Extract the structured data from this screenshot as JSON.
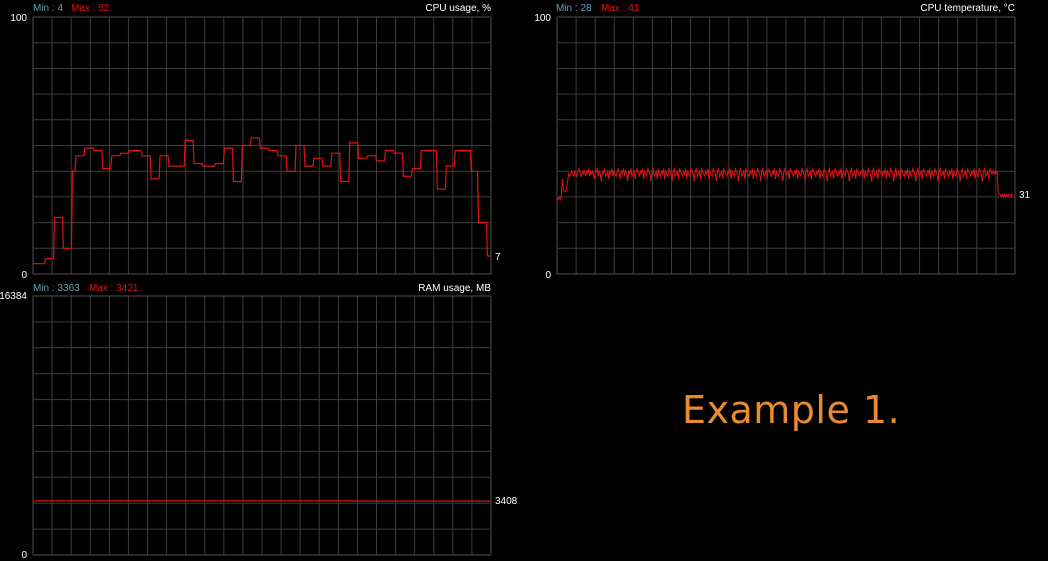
{
  "caption": "Example 1.",
  "colors": {
    "background": "#000000",
    "grid": "#3c3c3c",
    "plot_border": "#505050",
    "line": "#e01212",
    "min_text": "#6aa0b4",
    "max_text": "#e01212",
    "label_text": "#ffffff",
    "caption": "#e88b2e"
  },
  "chart_data": [
    {
      "type": "line",
      "title": "CPU usage, %",
      "min_label": "Min : 4",
      "max_label": "Max : 52",
      "y_top_label": "100",
      "y_bottom_label": "0",
      "current_label": "7",
      "ylim": [
        0,
        100
      ],
      "grid": true,
      "x_divisions": 24,
      "y_divisions": 10,
      "x": [
        0,
        1,
        2,
        3,
        4,
        5,
        6,
        7,
        8,
        9,
        10,
        11,
        12,
        13,
        14,
        15,
        16,
        17,
        18,
        19,
        20,
        21,
        22,
        23,
        24,
        25,
        26,
        27,
        28,
        29,
        30,
        31,
        32,
        33,
        34,
        35,
        36,
        37,
        38,
        39,
        40,
        41,
        42,
        43,
        44,
        45,
        46,
        47,
        48,
        49,
        50,
        51,
        52,
        53,
        54,
        55,
        56,
        57,
        58,
        59,
        60,
        61,
        62,
        63,
        64,
        65,
        66,
        67,
        68,
        69,
        70,
        71,
        72,
        73,
        74,
        75,
        76,
        77,
        78,
        79,
        80,
        81,
        82,
        83,
        84,
        85,
        86,
        87,
        88,
        89,
        90,
        91,
        92,
        93,
        94,
        95,
        96,
        97,
        98,
        99,
        100,
        101,
        102,
        103,
        104,
        105,
        106,
        107,
        108,
        109,
        110,
        111,
        112,
        113,
        114,
        115,
        116,
        117,
        118,
        119,
        120,
        121,
        122,
        123,
        124,
        125,
        126,
        127,
        128,
        129,
        130,
        131,
        132,
        133,
        134,
        135,
        136,
        137,
        138,
        139,
        140,
        141,
        142,
        143,
        144,
        145,
        146,
        147,
        148,
        149,
        150,
        151,
        152,
        153,
        154,
        155,
        156,
        157,
        158,
        159,
        160,
        161,
        162,
        163,
        164,
        165,
        166,
        167,
        168,
        169,
        170,
        171,
        172,
        173,
        174,
        175,
        176,
        177,
        178,
        179,
        180,
        181,
        182,
        183,
        184,
        185,
        186,
        187,
        188,
        189,
        190,
        191,
        192,
        193,
        194,
        195,
        196,
        197,
        198,
        199,
        200,
        201,
        202,
        203,
        204,
        205,
        206,
        207,
        208,
        209,
        210,
        211,
        212,
        213,
        214,
        215,
        216,
        217,
        218,
        219,
        220,
        221,
        222,
        223,
        224,
        225,
        226,
        227,
        228,
        229,
        230,
        231,
        232,
        233,
        234,
        235,
        236,
        237,
        238,
        239,
        240,
        241,
        242,
        243,
        244,
        245,
        246,
        247,
        248,
        249,
        250,
        251,
        252,
        253,
        254,
        255,
        256,
        257,
        258,
        259,
        260,
        261,
        262,
        263,
        264,
        265,
        266,
        267,
        268,
        269,
        270,
        271,
        272,
        273,
        274,
        275,
        276,
        277,
        278,
        279,
        280,
        281,
        282,
        283,
        284,
        285,
        286,
        287,
        288,
        289,
        290,
        291,
        292,
        293,
        294,
        295,
        296,
        297,
        298,
        299,
        300,
        301,
        302,
        303,
        304,
        305,
        306,
        307,
        308,
        309,
        310,
        311,
        312,
        313,
        314,
        315,
        316,
        317,
        318,
        319,
        320,
        321,
        322,
        323,
        324,
        325,
        326,
        327,
        328,
        329,
        330,
        331,
        332,
        333,
        334,
        335,
        336,
        337,
        338,
        339,
        340,
        341,
        342,
        343,
        344,
        345,
        346,
        347,
        348,
        349,
        350,
        351,
        352,
        353,
        354,
        355,
        356,
        357,
        358,
        359,
        360,
        361,
        362,
        363,
        364,
        365,
        366,
        367,
        368,
        369,
        370,
        371,
        372,
        373,
        374,
        375,
        376,
        377,
        378,
        379,
        380,
        381,
        382,
        383,
        384,
        385,
        386,
        387,
        388,
        389,
        390,
        391,
        392,
        393,
        394,
        395,
        396,
        397,
        398,
        399,
        400,
        401,
        402,
        403,
        404,
        405,
        406,
        407,
        408,
        409,
        410,
        411,
        412,
        413,
        414,
        415,
        416,
        417,
        418,
        419,
        420,
        421,
        422,
        423,
        424,
        425,
        426,
        427,
        428,
        429,
        430,
        431,
        432,
        433,
        434,
        435,
        436,
        437,
        438,
        439,
        440,
        441,
        442,
        443,
        444,
        445,
        446,
        447,
        448,
        449,
        450,
        451,
        452,
        453,
        454,
        455
      ],
      "values": [
        4,
        4,
        4,
        4,
        4,
        4,
        4,
        4,
        4,
        4,
        4,
        4,
        4,
        4,
        6,
        6,
        6,
        6,
        6,
        6,
        6,
        6,
        6,
        6,
        22,
        22,
        22,
        22,
        22,
        22,
        22,
        22,
        22,
        22,
        10,
        10,
        10,
        10,
        10,
        10,
        10,
        10,
        10,
        10,
        40,
        40,
        40,
        40,
        46,
        46,
        46,
        46,
        46,
        46,
        46,
        46,
        46,
        46,
        49,
        49,
        49,
        49,
        49,
        49,
        49,
        49,
        49,
        49,
        48,
        48,
        48,
        48,
        48,
        48,
        48,
        48,
        48,
        48,
        41,
        41,
        41,
        41,
        41,
        41,
        41,
        41,
        41,
        41,
        46,
        46,
        46,
        46,
        46,
        46,
        46,
        46,
        46,
        46,
        47,
        47,
        47,
        47,
        47,
        47,
        47,
        47,
        47,
        47,
        48,
        48,
        48,
        48,
        48,
        48,
        48,
        48,
        48,
        48,
        48,
        48,
        48,
        48,
        46,
        46,
        46,
        46,
        46,
        46,
        46,
        46,
        46,
        46,
        37,
        37,
        37,
        37,
        37,
        37,
        37,
        37,
        37,
        37,
        46,
        46,
        46,
        46,
        46,
        46,
        46,
        46,
        46,
        46,
        42,
        42,
        42,
        42,
        42,
        42,
        42,
        42,
        42,
        42,
        42,
        42,
        42,
        42,
        42,
        42,
        42,
        42,
        52,
        52,
        52,
        52,
        52,
        52,
        52,
        52,
        52,
        52,
        43,
        43,
        43,
        43,
        43,
        43,
        43,
        43,
        43,
        43,
        42,
        42,
        42,
        42,
        42,
        42,
        42,
        42,
        42,
        42,
        42,
        42,
        42,
        42,
        43,
        43,
        43,
        43,
        43,
        43,
        43,
        43,
        43,
        43,
        49,
        49,
        49,
        49,
        49,
        49,
        49,
        49,
        49,
        49,
        36,
        36,
        36,
        36,
        36,
        36,
        36,
        36,
        36,
        36,
        50,
        50,
        50,
        50,
        50,
        50,
        50,
        50,
        50,
        50,
        53,
        53,
        53,
        53,
        53,
        53,
        53,
        53,
        53,
        53,
        49,
        49,
        49,
        49,
        49,
        49,
        49,
        49,
        49,
        49,
        48,
        48,
        48,
        48,
        48,
        48,
        48,
        48,
        48,
        48,
        46,
        46,
        46,
        46,
        46,
        46,
        46,
        46,
        46,
        46,
        40,
        40,
        40,
        40,
        40,
        40,
        40,
        40,
        40,
        40,
        50,
        50,
        50,
        50,
        50,
        50,
        50,
        50,
        50,
        50,
        42,
        42,
        42,
        42,
        42,
        42,
        42,
        42,
        42,
        42,
        45,
        45,
        45,
        45,
        45,
        45,
        45,
        45,
        45,
        45,
        42,
        42,
        42,
        42,
        42,
        42,
        42,
        42,
        42,
        42,
        47,
        47,
        47,
        47,
        47,
        47,
        47,
        47,
        47,
        47,
        36,
        36,
        36,
        36,
        36,
        36,
        36,
        36,
        36,
        36,
        51,
        51,
        51,
        51,
        51,
        51,
        51,
        51,
        51,
        51,
        45,
        45,
        45,
        45,
        45,
        45,
        45,
        45,
        45,
        45,
        46,
        46,
        46,
        46,
        46,
        46,
        46,
        46,
        46,
        46,
        44,
        44,
        44,
        44,
        44,
        44,
        44,
        44,
        44,
        44,
        48,
        48,
        48,
        48,
        48,
        48,
        48,
        48,
        48,
        48,
        47,
        47,
        47,
        47,
        47,
        47,
        47,
        47,
        47,
        47,
        38,
        38,
        38,
        38,
        38,
        38,
        38,
        38,
        38,
        38,
        41,
        41,
        41,
        41,
        41,
        41,
        41,
        41,
        41,
        41,
        48,
        48,
        48,
        48,
        48,
        48,
        48,
        48,
        48,
        48,
        48,
        48,
        48,
        48,
        48,
        48,
        48,
        48,
        33,
        33,
        33,
        33,
        33,
        33,
        33,
        33,
        33,
        33,
        42,
        42,
        42,
        42,
        42,
        42,
        42,
        42,
        42,
        42,
        48,
        48,
        48,
        48,
        48,
        48,
        48,
        48,
        48,
        48,
        48,
        48,
        48,
        48,
        48,
        48,
        48,
        48,
        40,
        40,
        40,
        40,
        40,
        40,
        40,
        40,
        20,
        20,
        20,
        20,
        20,
        20,
        20,
        20,
        20,
        20,
        7,
        7,
        7,
        7,
        7
      ]
    },
    {
      "type": "line",
      "title": "CPU temperature, °C",
      "min_label": "Min : 28",
      "max_label": "Max : 41",
      "y_top_label": "100",
      "y_bottom_label": "0",
      "current_label": "31",
      "ylim": [
        0,
        100
      ],
      "grid": true,
      "x_divisions": 24,
      "y_divisions": 10,
      "seed_values": [
        29,
        29,
        30,
        29,
        30,
        37,
        33,
        32,
        32,
        33,
        36,
        39,
        38,
        39,
        40,
        39,
        38,
        40,
        39,
        38,
        40,
        41,
        39,
        38,
        40,
        39,
        40,
        38,
        40,
        39,
        41,
        38,
        40,
        39,
        40,
        37,
        39,
        40,
        41,
        38,
        40,
        39,
        36,
        40,
        39,
        41,
        38,
        39,
        40,
        37,
        40,
        39,
        41,
        38,
        40,
        39,
        38,
        40,
        41,
        39,
        37,
        40,
        39,
        41,
        38,
        40,
        39,
        36,
        40,
        39,
        41,
        38,
        39,
        40,
        37,
        40,
        41,
        39,
        38,
        40,
        39,
        41,
        37,
        40,
        39,
        38,
        41,
        40,
        39,
        36,
        40,
        41,
        38,
        39,
        40,
        37,
        41,
        39,
        38,
        40,
        39,
        41,
        37,
        40,
        39,
        38,
        41,
        40,
        39,
        36,
        40,
        41,
        38,
        39,
        40,
        37,
        41,
        40,
        39,
        38,
        40,
        39,
        41,
        37,
        40,
        39,
        38,
        41,
        40,
        39,
        36,
        40,
        41,
        38,
        39,
        40,
        37,
        41,
        40,
        39,
        38,
        40,
        39,
        41,
        37,
        40,
        39,
        38,
        41,
        40,
        39,
        36,
        40,
        41,
        38,
        39,
        40,
        37,
        41,
        40,
        39,
        38,
        40,
        39,
        41,
        37,
        40,
        39,
        38,
        41,
        40,
        39,
        36,
        40,
        41,
        38,
        39,
        40,
        37,
        41,
        40,
        39,
        38,
        40,
        39,
        41,
        37,
        40,
        39,
        38,
        41,
        40,
        39,
        36,
        40,
        41,
        38,
        39,
        40,
        37,
        41,
        40,
        39,
        38,
        40,
        39,
        41,
        37,
        40,
        39,
        38,
        41,
        40,
        39,
        36,
        40,
        41,
        38,
        39,
        40,
        37,
        41,
        40,
        39,
        38,
        40,
        39,
        41,
        37,
        40,
        39,
        38,
        41,
        40,
        39,
        36,
        40,
        41,
        38,
        39,
        40,
        37,
        41,
        40,
        39,
        38,
        40,
        39,
        41,
        37,
        40,
        39,
        38,
        41,
        40,
        39,
        36,
        40,
        41,
        38,
        39,
        40,
        37,
        41,
        40,
        39,
        38,
        40,
        39,
        41,
        37,
        40,
        39,
        38,
        41,
        40,
        39,
        36,
        40,
        41,
        38,
        39,
        40,
        37,
        41,
        40,
        39,
        38,
        40,
        39,
        41,
        37,
        40,
        39,
        38,
        41,
        40,
        39,
        36,
        40,
        41,
        38,
        39,
        40,
        37,
        41,
        40,
        39,
        38,
        40,
        39,
        41,
        37,
        40,
        39,
        38,
        41,
        40,
        39,
        36,
        40,
        41,
        38,
        39,
        40,
        37,
        41,
        40,
        39,
        38,
        40,
        39,
        41,
        37,
        40,
        39,
        38,
        41,
        40,
        39,
        36,
        40,
        41,
        38,
        39,
        40,
        37,
        41,
        40,
        39,
        38,
        40,
        39,
        41,
        37,
        40,
        39,
        38,
        41,
        40,
        39,
        36,
        40,
        41,
        38,
        39,
        40,
        37,
        41,
        40,
        39,
        38,
        40,
        39,
        41,
        37,
        40,
        39,
        38,
        41,
        40,
        39,
        36,
        40,
        41,
        38,
        39,
        40,
        37,
        41,
        40,
        39,
        38,
        40,
        39,
        41,
        37,
        40,
        39,
        38,
        41,
        40,
        39,
        36,
        40,
        41,
        38,
        39,
        40,
        37,
        41,
        40,
        39,
        40,
        39,
        40,
        39,
        40,
        32,
        31,
        31,
        30,
        31,
        30,
        31,
        30,
        31,
        30,
        31,
        31,
        30,
        31,
        31
      ]
    },
    {
      "type": "line",
      "title": "RAM usage, MB",
      "min_label": "Min : 3363",
      "max_label": "Max : 3421",
      "y_top_label": "16384",
      "y_bottom_label": "0",
      "current_label": "3408",
      "ylim": [
        0,
        16384
      ],
      "grid": true,
      "x_divisions": 24,
      "y_divisions": 10,
      "segments": [
        {
          "from": 0,
          "to": 320,
          "value": 3421
        },
        {
          "from": 320,
          "to": 322,
          "value": 3408
        },
        {
          "from": 322,
          "to": 456,
          "value": 3408
        }
      ]
    }
  ]
}
